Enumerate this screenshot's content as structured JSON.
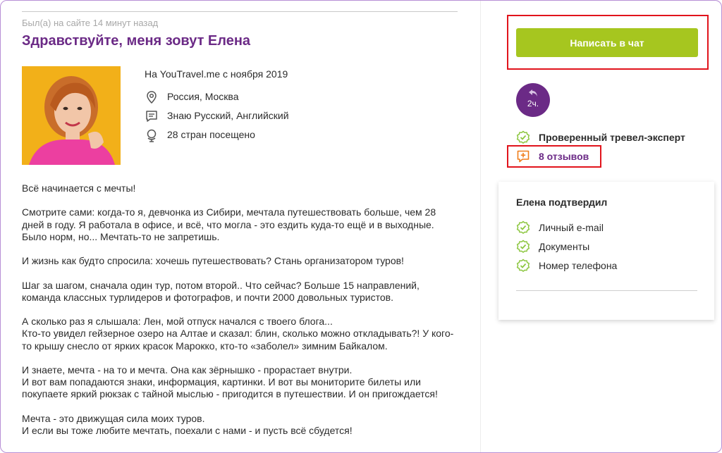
{
  "profile": {
    "last_seen": "Был(а) на сайте 14 минут назад",
    "title": "Здравствуйте, меня зовут Елена",
    "facts": [
      {
        "icon": "none",
        "text": "На YouTravel.me с ноября 2019"
      },
      {
        "icon": "location-pin-icon",
        "text": "Россия, Москва"
      },
      {
        "icon": "speech-bubble-icon",
        "text": "Знаю Русский, Английский"
      },
      {
        "icon": "globe-icon",
        "text": "28 стран посещено"
      }
    ],
    "bio": [
      "Всё начинается с мечты!",
      "Смотрите сами: когда-то я, девчонка из Сибири, мечтала путешествовать больше, чем 28 дней в году. Я работала в офисе, и всё, что могла - это ездить куда-то ещё и в выходные. Было норм, но... Мечтать-то не запретишь.",
      "И жизнь как будто спросила: хочешь путешествовать? Стань организатором туров!",
      "Шаг за шагом, сначала один тур, потом второй.. Что сейчас? Больше 15 направлений, команда классных турлидеров и фотографов, и почти 2000 довольных туристов.",
      "А сколько раз я слышала: Лен, мой отпуск начался с твоего блога...\nКто-то увидел гейзерное озеро на Алтае и сказал: блин, сколько можно откладывать?! У кого-то крышу снесло от ярких красок Марокко, кто-то «заболел» зимним Байкалом.",
      "И знаете, мечта - на то и мечта. Она как зёрнышко - прорастает внутри.\nИ вот вам попадаются знаки, информация, картинки. И вот вы мониторите билеты или покупаете яркий рюкзак с тайной мыслью - пригодится в путешествии. И он пригождается!",
      "Мечта - это движущая сила моих туров.\nИ если вы тоже любите мечтать, поехали с нами - и пусть всё сбудется!"
    ]
  },
  "sidebar": {
    "chat_button": "Написать в чат",
    "reply_time": "2ч.",
    "badges": [
      {
        "icon": "check-badge-icon",
        "text": "Проверенный тревел-эксперт",
        "color": "#2b2b2b"
      },
      {
        "icon": "add-review-icon",
        "text": "8 отзывов",
        "color": "#6b2a86"
      }
    ],
    "verified_title": "Елена подтвердил",
    "verified_items": [
      "Личный e-mail",
      "Документы",
      "Номер телефона"
    ]
  },
  "colors": {
    "accent_purple": "#6b2a86",
    "chat_green": "#a6c61f",
    "check_green": "#8cc63f",
    "review_orange": "#f07d1a",
    "highlight_red": "#e1141c"
  }
}
